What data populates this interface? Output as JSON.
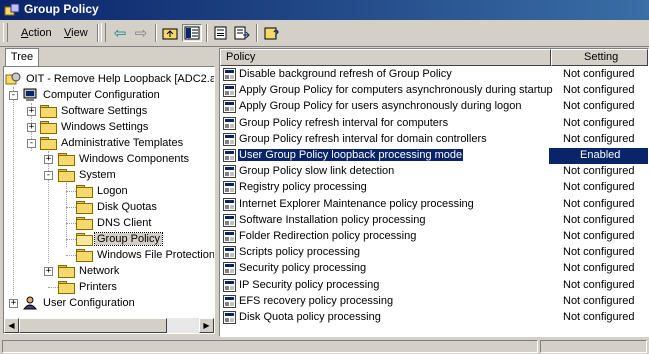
{
  "window": {
    "title": "Group Policy"
  },
  "menu": {
    "items": [
      {
        "underline": "A",
        "rest": "ction"
      },
      {
        "underline": "V",
        "rest": "iew"
      }
    ]
  },
  "toolbar": {
    "buttons": [
      "back-icon",
      "forward-icon",
      "up-folder-icon",
      "show-hide-tree-icon",
      "properties-icon",
      "export-list-icon",
      "help-icon"
    ]
  },
  "tree": {
    "tab_label": "Tree",
    "root_label": "OIT - Remove Help Loopback [ADC2.ad.b",
    "computer_config": "Computer Configuration",
    "software_settings": "Software Settings",
    "windows_settings": "Windows Settings",
    "admin_templates": "Administrative Templates",
    "windows_components": "Windows Components",
    "system": "System",
    "logon": "Logon",
    "disk_quotas": "Disk Quotas",
    "dns_client": "DNS Client",
    "group_policy": "Group Policy",
    "windows_file_protection": "Windows File Protection",
    "network": "Network",
    "printers": "Printers",
    "user_config": "User Configuration"
  },
  "list": {
    "col_policy": "Policy",
    "col_setting": "Setting",
    "rows": [
      {
        "name": "Disable background refresh of Group Policy",
        "setting": "Not configured"
      },
      {
        "name": "Apply Group Policy for computers asynchronously during startup",
        "setting": "Not configured"
      },
      {
        "name": "Apply Group Policy for users asynchronously during logon",
        "setting": "Not configured"
      },
      {
        "name": "Group Policy refresh interval for computers",
        "setting": "Not configured"
      },
      {
        "name": "Group Policy refresh interval for domain controllers",
        "setting": "Not configured"
      },
      {
        "name": "User Group Policy loopback processing mode",
        "setting": "Enabled"
      },
      {
        "name": "Group Policy slow link detection",
        "setting": "Not configured"
      },
      {
        "name": "Registry policy processing",
        "setting": "Not configured"
      },
      {
        "name": "Internet Explorer Maintenance policy processing",
        "setting": "Not configured"
      },
      {
        "name": "Software Installation policy processing",
        "setting": "Not configured"
      },
      {
        "name": "Folder Redirection policy processing",
        "setting": "Not configured"
      },
      {
        "name": "Scripts policy processing",
        "setting": "Not configured"
      },
      {
        "name": "Security policy processing",
        "setting": "Not configured"
      },
      {
        "name": "IP Security policy processing",
        "setting": "Not configured"
      },
      {
        "name": "EFS recovery policy processing",
        "setting": "Not configured"
      },
      {
        "name": "Disk Quota policy processing",
        "setting": "Not configured"
      }
    ]
  },
  "colors": {
    "title_start": "#0a246a",
    "title_end": "#3a6ea5",
    "selection": "#0a246a",
    "chrome": "#d4d0c8"
  }
}
